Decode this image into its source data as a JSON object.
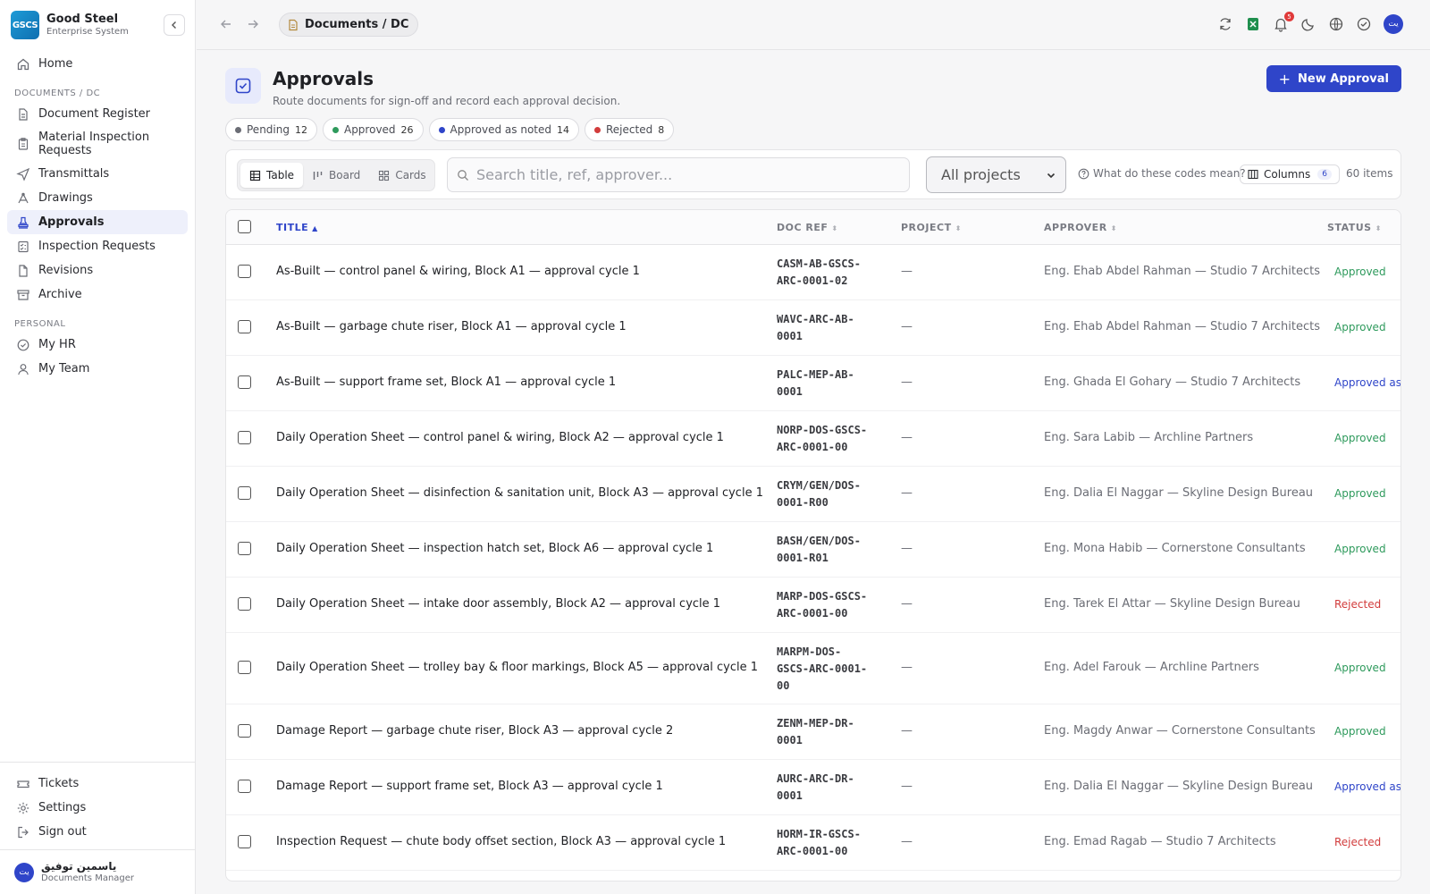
{
  "app": {
    "logo_text": "GSCS",
    "name": "Good Steel",
    "subtitle": "Enterprise System"
  },
  "sidebar": {
    "home": "Home",
    "section_docs": "DOCUMENTS / DC",
    "items": [
      {
        "label": "Document Register",
        "icon": "document-icon"
      },
      {
        "label": "Material Inspection Requests",
        "icon": "clipboard-icon"
      },
      {
        "label": "Transmittals",
        "icon": "send-icon"
      },
      {
        "label": "Drawings",
        "icon": "compass-icon"
      },
      {
        "label": "Approvals",
        "icon": "stamp-icon",
        "active": true
      },
      {
        "label": "Inspection Requests",
        "icon": "checklist-icon"
      },
      {
        "label": "Revisions",
        "icon": "file-icon"
      },
      {
        "label": "Archive",
        "icon": "archive-icon"
      }
    ],
    "section_personal": "PERSONAL",
    "personal": [
      {
        "label": "My HR",
        "icon": "check-circle-icon"
      },
      {
        "label": "My Team",
        "icon": "user-icon"
      }
    ],
    "bottom": [
      {
        "label": "Tickets",
        "icon": "ticket-icon"
      },
      {
        "label": "Settings",
        "icon": "gear-icon"
      },
      {
        "label": "Sign out",
        "icon": "logout-icon"
      }
    ],
    "user": {
      "initials": "يت",
      "name": "ياسمين توفيق",
      "role": "Documents Manager"
    }
  },
  "topbar": {
    "breadcrumb": "Documents / DC",
    "notification_count": "5",
    "user_initials": "يت"
  },
  "page": {
    "title": "Approvals",
    "subtitle": "Route documents for sign-off and record each approval decision.",
    "new_button": "New Approval"
  },
  "status_chips": [
    {
      "label": "Pending",
      "count": "12",
      "color": "#6b6d75"
    },
    {
      "label": "Approved",
      "count": "26",
      "color": "#2e9a5c"
    },
    {
      "label": "Approved as noted",
      "count": "14",
      "color": "#2f45c9"
    },
    {
      "label": "Rejected",
      "count": "8",
      "color": "#d23c3c"
    }
  ],
  "toolbar": {
    "views": [
      "Table",
      "Board",
      "Cards"
    ],
    "search_placeholder": "Search title, ref, approver...",
    "project_filter": "All projects",
    "help": "What do these codes mean?",
    "columns_label": "Columns",
    "columns_count": "6",
    "items_count": "60 items"
  },
  "table": {
    "headers": {
      "title": "TITLE",
      "doc_ref": "DOC REF",
      "project": "PROJECT",
      "approver": "APPROVER",
      "status": "STATUS"
    },
    "rows": [
      {
        "title": "As-Built — control panel & wiring, Block A1 — approval cycle 1",
        "ref": [
          "CASM-AB-GSCS-",
          "ARC-0001-02"
        ],
        "project": "—",
        "approver": "Eng. Ehab Abdel Rahman — Studio 7 Architects",
        "status": "Approved",
        "status_color": "#2e9a5c"
      },
      {
        "title": "As-Built — garbage chute riser, Block A1 — approval cycle 1",
        "ref": [
          "WAVC-ARC-AB-",
          "0001"
        ],
        "project": "—",
        "approver": "Eng. Ehab Abdel Rahman — Studio 7 Architects",
        "status": "Approved",
        "status_color": "#2e9a5c"
      },
      {
        "title": "As-Built — support frame set, Block A1 — approval cycle 1",
        "ref": [
          "PALC-MEP-AB-",
          "0001"
        ],
        "project": "—",
        "approver": "Eng. Ghada El Gohary — Studio 7 Architects",
        "status": "Approved as",
        "status_color": "#2f45c9"
      },
      {
        "title": "Daily Operation Sheet — control panel & wiring, Block A2 — approval cycle 1",
        "ref": [
          "NORP-DOS-GSCS-",
          "ARC-0001-00"
        ],
        "project": "—",
        "approver": "Eng. Sara Labib — Archline Partners",
        "status": "Approved",
        "status_color": "#2e9a5c"
      },
      {
        "title": "Daily Operation Sheet — disinfection & sanitation unit, Block A3 — approval cycle 1",
        "ref": [
          "CRYM/GEN/DOS-",
          "0001-R00"
        ],
        "project": "—",
        "approver": "Eng. Dalia El Naggar — Skyline Design Bureau",
        "status": "Approved",
        "status_color": "#2e9a5c"
      },
      {
        "title": "Daily Operation Sheet — inspection hatch set, Block A6 — approval cycle 1",
        "ref": [
          "BASH/GEN/DOS-",
          "0001-R01"
        ],
        "project": "—",
        "approver": "Eng. Mona Habib — Cornerstone Consultants",
        "status": "Approved",
        "status_color": "#2e9a5c"
      },
      {
        "title": "Daily Operation Sheet — intake door assembly, Block A2 — approval cycle 1",
        "ref": [
          "MARP-DOS-GSCS-",
          "ARC-0001-00"
        ],
        "project": "—",
        "approver": "Eng. Tarek El Attar — Skyline Design Bureau",
        "status": "Rejected",
        "status_color": "#d23c3c"
      },
      {
        "title": "Daily Operation Sheet — trolley bay & floor markings, Block A5 — approval cycle 1",
        "ref": [
          "MARPM-DOS-",
          "GSCS-ARC-0001-",
          "00"
        ],
        "project": "—",
        "approver": "Eng. Adel Farouk — Archline Partners",
        "status": "Approved",
        "status_color": "#2e9a5c"
      },
      {
        "title": "Damage Report — garbage chute riser, Block A3 — approval cycle 2",
        "ref": [
          "ZENM-MEP-DR-",
          "0001"
        ],
        "project": "—",
        "approver": "Eng. Magdy Anwar — Cornerstone Consultants",
        "status": "Approved",
        "status_color": "#2e9a5c"
      },
      {
        "title": "Damage Report — support frame set, Block A3 — approval cycle 1",
        "ref": [
          "AURC-ARC-DR-",
          "0001"
        ],
        "project": "—",
        "approver": "Eng. Dalia El Naggar — Skyline Design Bureau",
        "status": "Approved as",
        "status_color": "#2f45c9"
      },
      {
        "title": "Inspection Request — chute body offset section, Block A3 — approval cycle 1",
        "ref": [
          "HORM-IR-GSCS-",
          "ARC-0001-00"
        ],
        "project": "—",
        "approver": "Eng. Emad Ragab — Studio 7 Architects",
        "status": "Rejected",
        "status_color": "#d23c3c"
      }
    ]
  }
}
